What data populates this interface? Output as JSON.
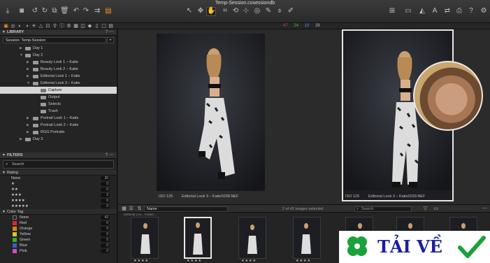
{
  "window": {
    "title": "Temp-Session.cosessiondb"
  },
  "color_counts": [
    {
      "value": "47",
      "color": "#e04040"
    },
    {
      "value": "24",
      "color": "#3cc43c"
    },
    {
      "value": "10",
      "color": "#5a8af0"
    },
    {
      "value": "29",
      "color": "#b9b9b9"
    }
  ],
  "library": {
    "header": "LIBRARY",
    "session": "Session: Temp-Session",
    "tree": [
      {
        "label": "Day 1",
        "level": 1,
        "selected": false
      },
      {
        "label": "Day 2",
        "level": 1,
        "selected": false
      },
      {
        "label": "Beauty Look 1 – Katie",
        "level": 2,
        "selected": false
      },
      {
        "label": "Beauty Look 2 – Katie",
        "level": 2,
        "selected": false
      },
      {
        "label": "Editorial Look 1 – Katie",
        "level": 2,
        "selected": false
      },
      {
        "label": "Editorial Look 3 – Katie",
        "level": 2,
        "selected": false
      },
      {
        "label": "Capture",
        "level": 3,
        "selected": true
      },
      {
        "label": "Output",
        "level": 3,
        "selected": false
      },
      {
        "label": "Selects",
        "level": 3,
        "selected": false
      },
      {
        "label": "Trash",
        "level": 3,
        "selected": false
      },
      {
        "label": "Portrait Look 1 – Katie",
        "level": 2,
        "selected": false
      },
      {
        "label": "Portrait Look 2 – Katie",
        "level": 2,
        "selected": false
      },
      {
        "label": "RGG Portraits",
        "level": 2,
        "selected": false
      },
      {
        "label": "Day 3",
        "level": 1,
        "selected": false
      }
    ]
  },
  "filters": {
    "header": "FILTERS",
    "search_placeholder": "Search",
    "rating_label": "Rating",
    "ratings": [
      {
        "label": "None",
        "count": "26"
      },
      {
        "label": "★",
        "count": "0"
      },
      {
        "label": "★★",
        "count": "0"
      },
      {
        "label": "★★★",
        "count": "2"
      },
      {
        "label": "★★★★",
        "count": "6"
      },
      {
        "label": "★★★★★",
        "count": "0"
      }
    ],
    "color_tag_label": "Color Tag",
    "color_tags": [
      {
        "label": "None",
        "count": "42",
        "color": "transparent"
      },
      {
        "label": "Red",
        "count": "0",
        "color": "#d03030"
      },
      {
        "label": "Orange",
        "count": "0",
        "color": "#e08020"
      },
      {
        "label": "Yellow",
        "count": "0",
        "color": "#d8c820"
      },
      {
        "label": "Green",
        "count": "0",
        "color": "#30b030"
      },
      {
        "label": "Blue",
        "count": "0",
        "color": "#3060d0"
      },
      {
        "label": "Pink",
        "count": "0",
        "color": "#d050c0"
      }
    ]
  },
  "viewer": {
    "left_image": {
      "iso": "ISO 125",
      "name": "Editorial Look 3 – Katie0238.NEF"
    },
    "right_image": {
      "iso": "ISO 125",
      "name": "Editorial Look 3 – Katie0239.NEF"
    }
  },
  "browser": {
    "sort_value": "Name",
    "selected_info": "2 of 42 images selected",
    "search_placeholder": "Search",
    "thumbs": [
      {
        "stars": "★★★★",
        "selected": false
      },
      {
        "stars": "★★★★",
        "selected": true
      },
      {
        "stars": "★★★★",
        "selected": false
      },
      {
        "stars": "★★★★",
        "selected": false
      },
      {
        "stars": "★★★★",
        "selected": false
      },
      {
        "stars": "★★★★",
        "selected": false
      },
      {
        "stars": "★★★★",
        "selected": false
      }
    ],
    "thumb_label": "Editorial Loo... Katie0..."
  },
  "watermark": {
    "text": "TẢI VỀ",
    "accent": "#1aa23a"
  }
}
